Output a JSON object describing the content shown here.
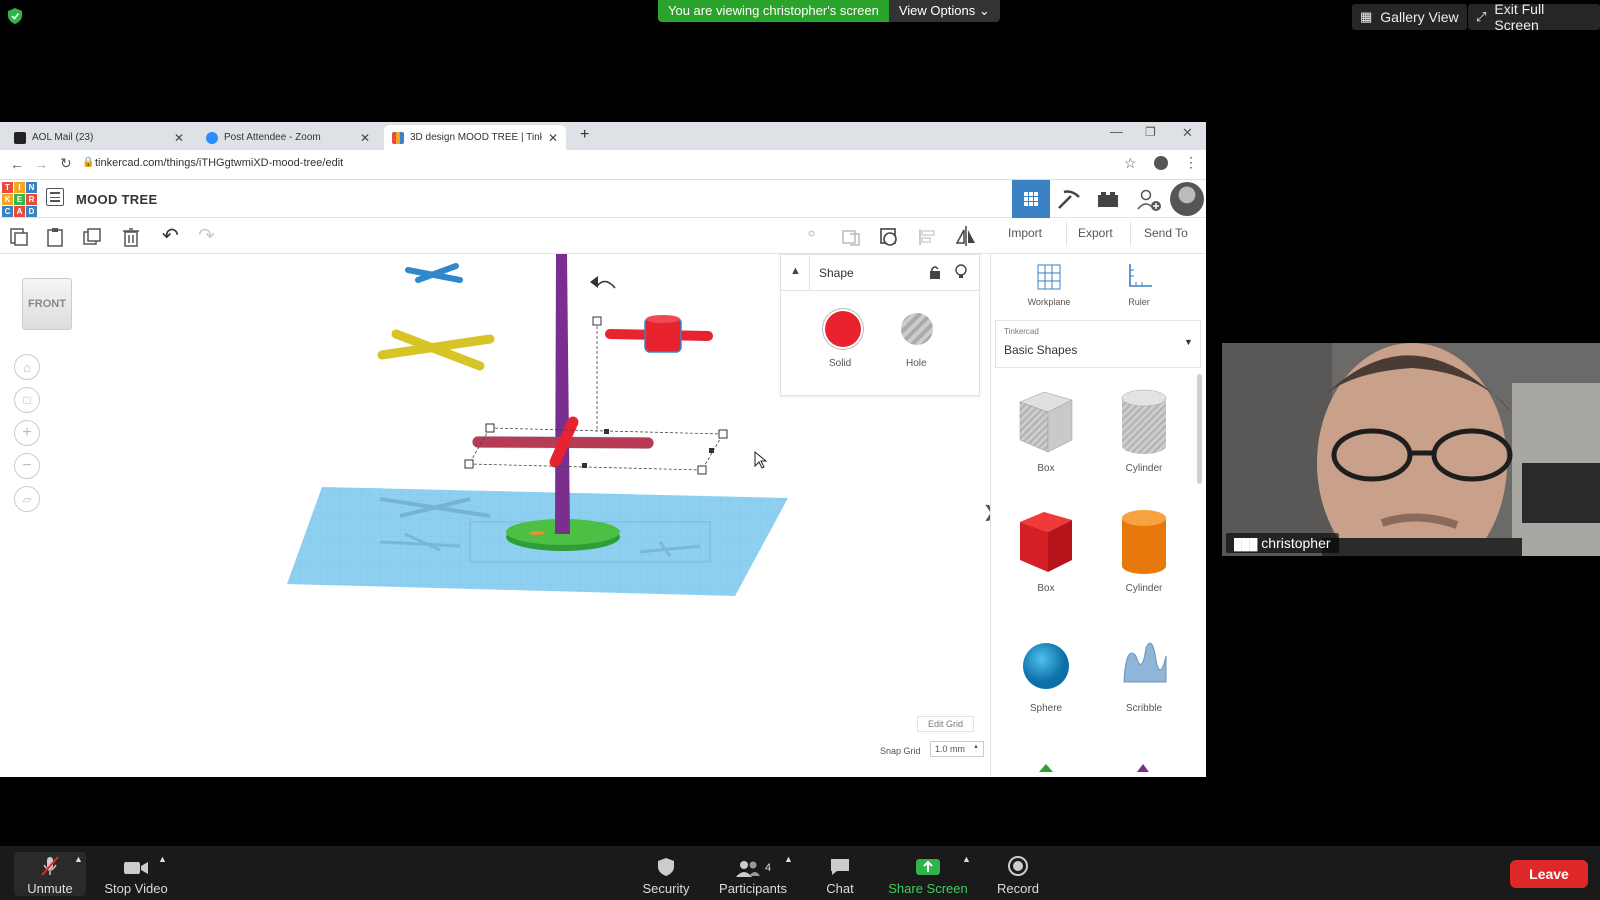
{
  "zoom": {
    "banner_text": "You are viewing christopher's screen",
    "view_options_label": "View Options",
    "gallery_view_label": "Gallery View",
    "exit_full_screen_label": "Exit Full Screen",
    "participant_name": "christopher",
    "participants_count": "4",
    "bottom": {
      "unmute": "Unmute",
      "stop_video": "Stop Video",
      "security": "Security",
      "participants": "Participants",
      "chat": "Chat",
      "share_screen": "Share Screen",
      "record": "Record",
      "leave": "Leave"
    }
  },
  "browser": {
    "tabs": [
      {
        "label": "AOL Mail (23)",
        "color": "#222222"
      },
      {
        "label": "Post Attendee - Zoom",
        "color": "#2d8cff"
      },
      {
        "label": "3D design MOOD TREE | Tinkerc",
        "color": "#e84c3d"
      }
    ],
    "url": "tinkercad.com/things/iTHGgtwmiXD-mood-tree/edit"
  },
  "tinkercad": {
    "logo_letters": [
      "T",
      "I",
      "N",
      "K",
      "E",
      "R",
      "C",
      "A",
      "D"
    ],
    "design_title": "MOOD TREE",
    "toolbar": {
      "import": "Import",
      "export": "Export",
      "send_to": "Send To"
    },
    "view_cube_label": "FRONT",
    "shape_panel": {
      "title": "Shape",
      "solid": "Solid",
      "hole": "Hole"
    },
    "sidebar": {
      "workplane": "Workplane",
      "ruler": "Ruler",
      "library_source": "Tinkercad",
      "library_name": "Basic Shapes",
      "shapes": [
        "Box",
        "Cylinder",
        "Box",
        "Cylinder",
        "Sphere",
        "Scribble"
      ]
    },
    "edit_grid": "Edit Grid",
    "snap_grid_label": "Snap Grid",
    "snap_grid_value": "1.0 mm"
  },
  "colors": {
    "zoom_green": "#29a329",
    "tinkercad_blue": "#3b82c4",
    "workplane": "#8fd0f0",
    "shape_red": "#e8222e",
    "leave_red": "#e02828"
  }
}
